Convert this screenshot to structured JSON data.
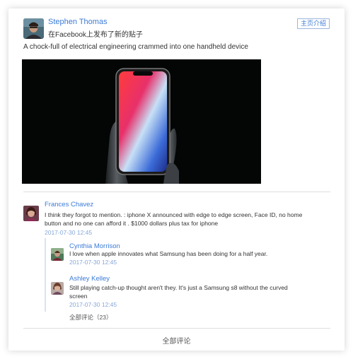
{
  "post": {
    "author_name": "Stephen Thomas",
    "action_text": "在Facebook上发布了新的贴子",
    "homepage_button": "主页介绍",
    "text": "A chock-full of electrical engineering crammed into one handheld device"
  },
  "comments": [
    {
      "name": "Frances Chavez",
      "text_line1": "I think they forgot to mention. : iphone X announced with edge to edge screen, Face ID, no home",
      "text_line2": "button and no one can afford it . $1000 dollars plus tax for iphone",
      "time": "2017-07-30   12:45",
      "replies": [
        {
          "name": "Cynthia Morrison",
          "text_line1": " I love when apple innovates what Samsung has been doing for a half year.",
          "text_line2": "",
          "time": "2017-07-30   12:45"
        },
        {
          "name": "Ashley Kelley",
          "text_line1": "Still playing catch-up thought aren't they. It's just a Samsung s8 without the curved",
          "text_line2": "screen",
          "time": "2017-07-30   12:45"
        }
      ],
      "all_replies_label": "全部评论（23）"
    }
  ],
  "footer": {
    "all_comments_label": "全部评论"
  },
  "colors": {
    "link_blue": "#3c7bd6",
    "time_blue": "#86a7d8"
  }
}
